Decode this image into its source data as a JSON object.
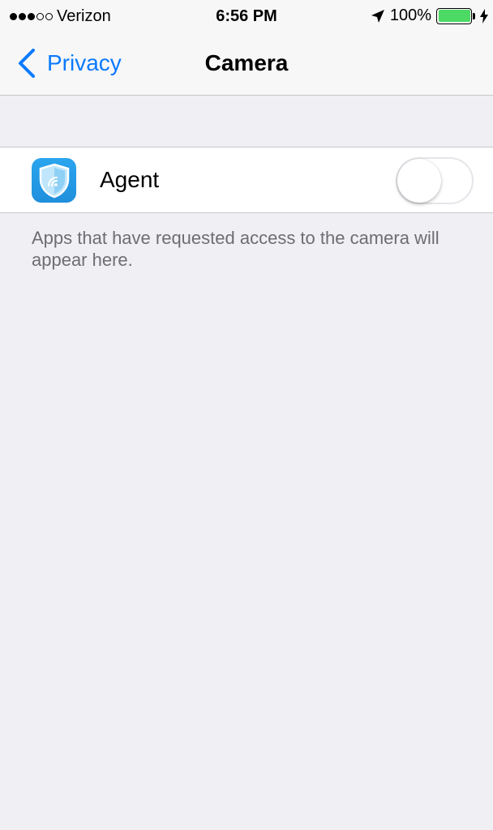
{
  "status_bar": {
    "carrier": "Verizon",
    "signal_bars_filled": 3,
    "signal_bars_total": 5,
    "time": "6:56 PM",
    "battery_percent": "100%",
    "battery_level": 1.0,
    "battery_color": "#4cd964",
    "location_icon": "location-arrow-icon",
    "charging_icon": "bolt-icon"
  },
  "nav": {
    "back_label": "Privacy",
    "title": "Camera",
    "accent_color": "#0a7aff"
  },
  "apps": [
    {
      "name": "Agent",
      "icon": "shield-wifi-icon",
      "enabled": false
    }
  ],
  "footer_note": "Apps that have requested access to the camera will appear here."
}
